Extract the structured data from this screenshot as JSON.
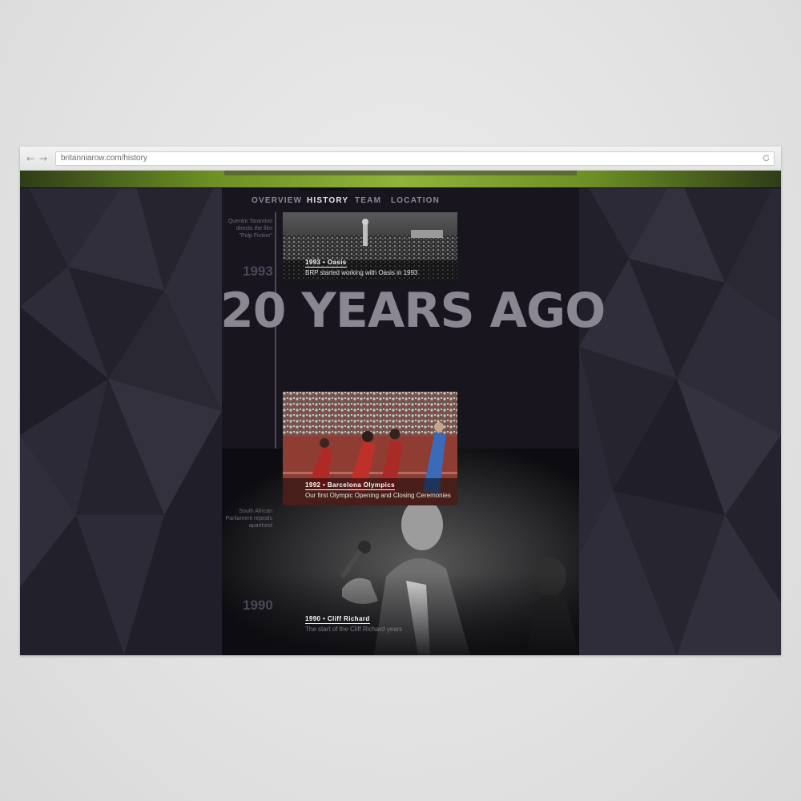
{
  "browser": {
    "url": "britanniarow.com/history",
    "back_icon": "back-arrow-icon",
    "forward_icon": "forward-arrow-icon",
    "reload_icon": "reload-icon"
  },
  "nav": {
    "items": [
      {
        "label": "OVERVIEW",
        "active": false
      },
      {
        "label": "HISTORY",
        "active": true
      },
      {
        "label": "TEAM",
        "active": false
      },
      {
        "label": "LOCATION",
        "active": false
      }
    ]
  },
  "timeline": {
    "headline": "20 YEARS AGO",
    "side_notes": [
      {
        "lines": [
          "Quentin Tarantino",
          "directs the film",
          "\"Pulp Fiction\""
        ]
      },
      {
        "lines": [
          "South African",
          "Parliament repeals",
          "apartheid"
        ]
      }
    ],
    "years": [
      "1993",
      "1990"
    ],
    "events": [
      {
        "title": "1993 • Oasis",
        "text": "BRP started working with Oasis in 1993"
      },
      {
        "title": "1992 • Barcelona Olympics",
        "text": "Our first Olympic Opening and Closing Ceremonies"
      },
      {
        "title": "1990 • Cliff Richard",
        "text": "The start of the Cliff Richard years"
      }
    ]
  },
  "colors": {
    "background": "#26242f",
    "nav_active": "#e9e7ef",
    "nav_inactive": "#8d8a99",
    "headline": "#8a8793",
    "hero_green": "#8fb43a"
  }
}
